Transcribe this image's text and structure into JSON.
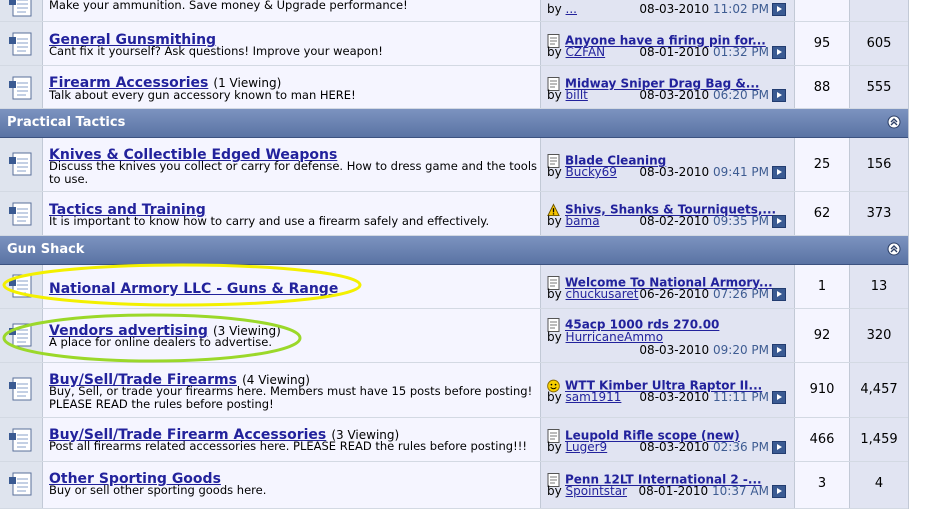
{
  "rows": [
    {
      "title": "",
      "viewing": "",
      "desc": "Make your ammunition. Save money & Upgrade performance!",
      "lp_title": "",
      "lp_by": "by",
      "lp_user": "...",
      "lp_date": "08-03-2010",
      "lp_time": "11:02 PM",
      "threads": "",
      "posts": "",
      "lp_icon": "doc-icon"
    },
    {
      "title": "General Gunsmithing",
      "viewing": "",
      "desc": "Cant fix it yourself? Ask questions! Improve your weapon!",
      "lp_title": "Anyone have a firing pin for...",
      "lp_by": "by",
      "lp_user": "CZFAN",
      "lp_date": "08-01-2010",
      "lp_time": "01:32 PM",
      "threads": "95",
      "posts": "605",
      "lp_icon": "doc-icon"
    },
    {
      "title": "Firearm Accessories",
      "viewing": "(1 Viewing)",
      "desc": "Talk about every gun accessory known to man HERE!",
      "lp_title": "Midway Sniper Drag Bag &...",
      "lp_by": "by",
      "lp_user": "billt",
      "lp_date": "08-03-2010",
      "lp_time": "06:20 PM",
      "threads": "88",
      "posts": "555",
      "lp_icon": "doc-icon"
    },
    {
      "title": "Knives & Collectible Edged Weapons",
      "viewing": "",
      "desc": "Discuss the knives you collect or carry for defense. How to dress game and the tools to use.",
      "lp_title": "Blade Cleaning",
      "lp_by": "by",
      "lp_user": "Bucky69",
      "lp_date": "08-03-2010",
      "lp_time": "09:41 PM",
      "threads": "25",
      "posts": "156",
      "lp_icon": "doc-icon"
    },
    {
      "title": "Tactics and Training",
      "viewing": "",
      "desc": "It is important to know how to carry and use a firearm safely and effectively.",
      "lp_title": "Shivs, Shanks & Tourniquets,...",
      "lp_by": "by",
      "lp_user": "bama",
      "lp_date": "08-02-2010",
      "lp_time": "09:35 PM",
      "threads": "62",
      "posts": "373",
      "lp_icon": "warning-icon"
    },
    {
      "title": "National Armory LLC - Guns & Range",
      "viewing": "",
      "desc": "",
      "lp_title": "Welcome To National Armory...",
      "lp_by": "by",
      "lp_user": "chuckusaret",
      "lp_date": "06-26-2010",
      "lp_time": "07:26 PM",
      "threads": "1",
      "posts": "13",
      "lp_icon": "doc-icon"
    },
    {
      "title": "Vendors advertising",
      "viewing": "(3 Viewing)",
      "desc": "A place for online dealers to advertise.",
      "lp_title": "45acp 1000 rds 270.00",
      "lp_by": "by",
      "lp_user": "HurricaneAmmo",
      "lp_date": "08-03-2010",
      "lp_time": "09:20 PM",
      "threads": "92",
      "posts": "320",
      "lp_icon": "doc-icon"
    },
    {
      "title": "Buy/Sell/Trade Firearms",
      "viewing": "(4 Viewing)",
      "desc": "Buy, Sell, or trade your firearms here. Members must have 15 posts before posting! PLEASE READ the rules before posting!",
      "lp_title": "WTT Kimber Ultra Raptor II...",
      "lp_by": "by",
      "lp_user": "sam1911",
      "lp_date": "08-03-2010",
      "lp_time": "11:11 PM",
      "threads": "910",
      "posts": "4,457",
      "lp_icon": "smiley-icon"
    },
    {
      "title": "Buy/Sell/Trade Firearm Accessories",
      "viewing": "(3 Viewing)",
      "desc": "Post all firearms related accessories here. PLEASE READ the rules before posting!!!",
      "lp_title": "Leupold Rifle scope (new)",
      "lp_by": "by",
      "lp_user": "Luger9",
      "lp_date": "08-03-2010",
      "lp_time": "02:36 PM",
      "threads": "466",
      "posts": "1,459",
      "lp_icon": "doc-icon"
    },
    {
      "title": "Other Sporting Goods",
      "viewing": "",
      "desc": "Buy or sell other sporting goods here.",
      "lp_title": "Penn 12LT International 2 -...",
      "lp_by": "by",
      "lp_user": "Spointstar",
      "lp_date": "08-01-2010",
      "lp_time": "10:37 AM",
      "threads": "3",
      "posts": "4",
      "lp_icon": "doc-icon"
    }
  ],
  "categories": [
    {
      "title": "Practical Tactics"
    },
    {
      "title": "Gun Shack"
    }
  ],
  "colors": {
    "link": "#22229c",
    "header": "#5a73a4",
    "highlight_yellow": "#f3f000",
    "highlight_green": "#9bd82a"
  }
}
